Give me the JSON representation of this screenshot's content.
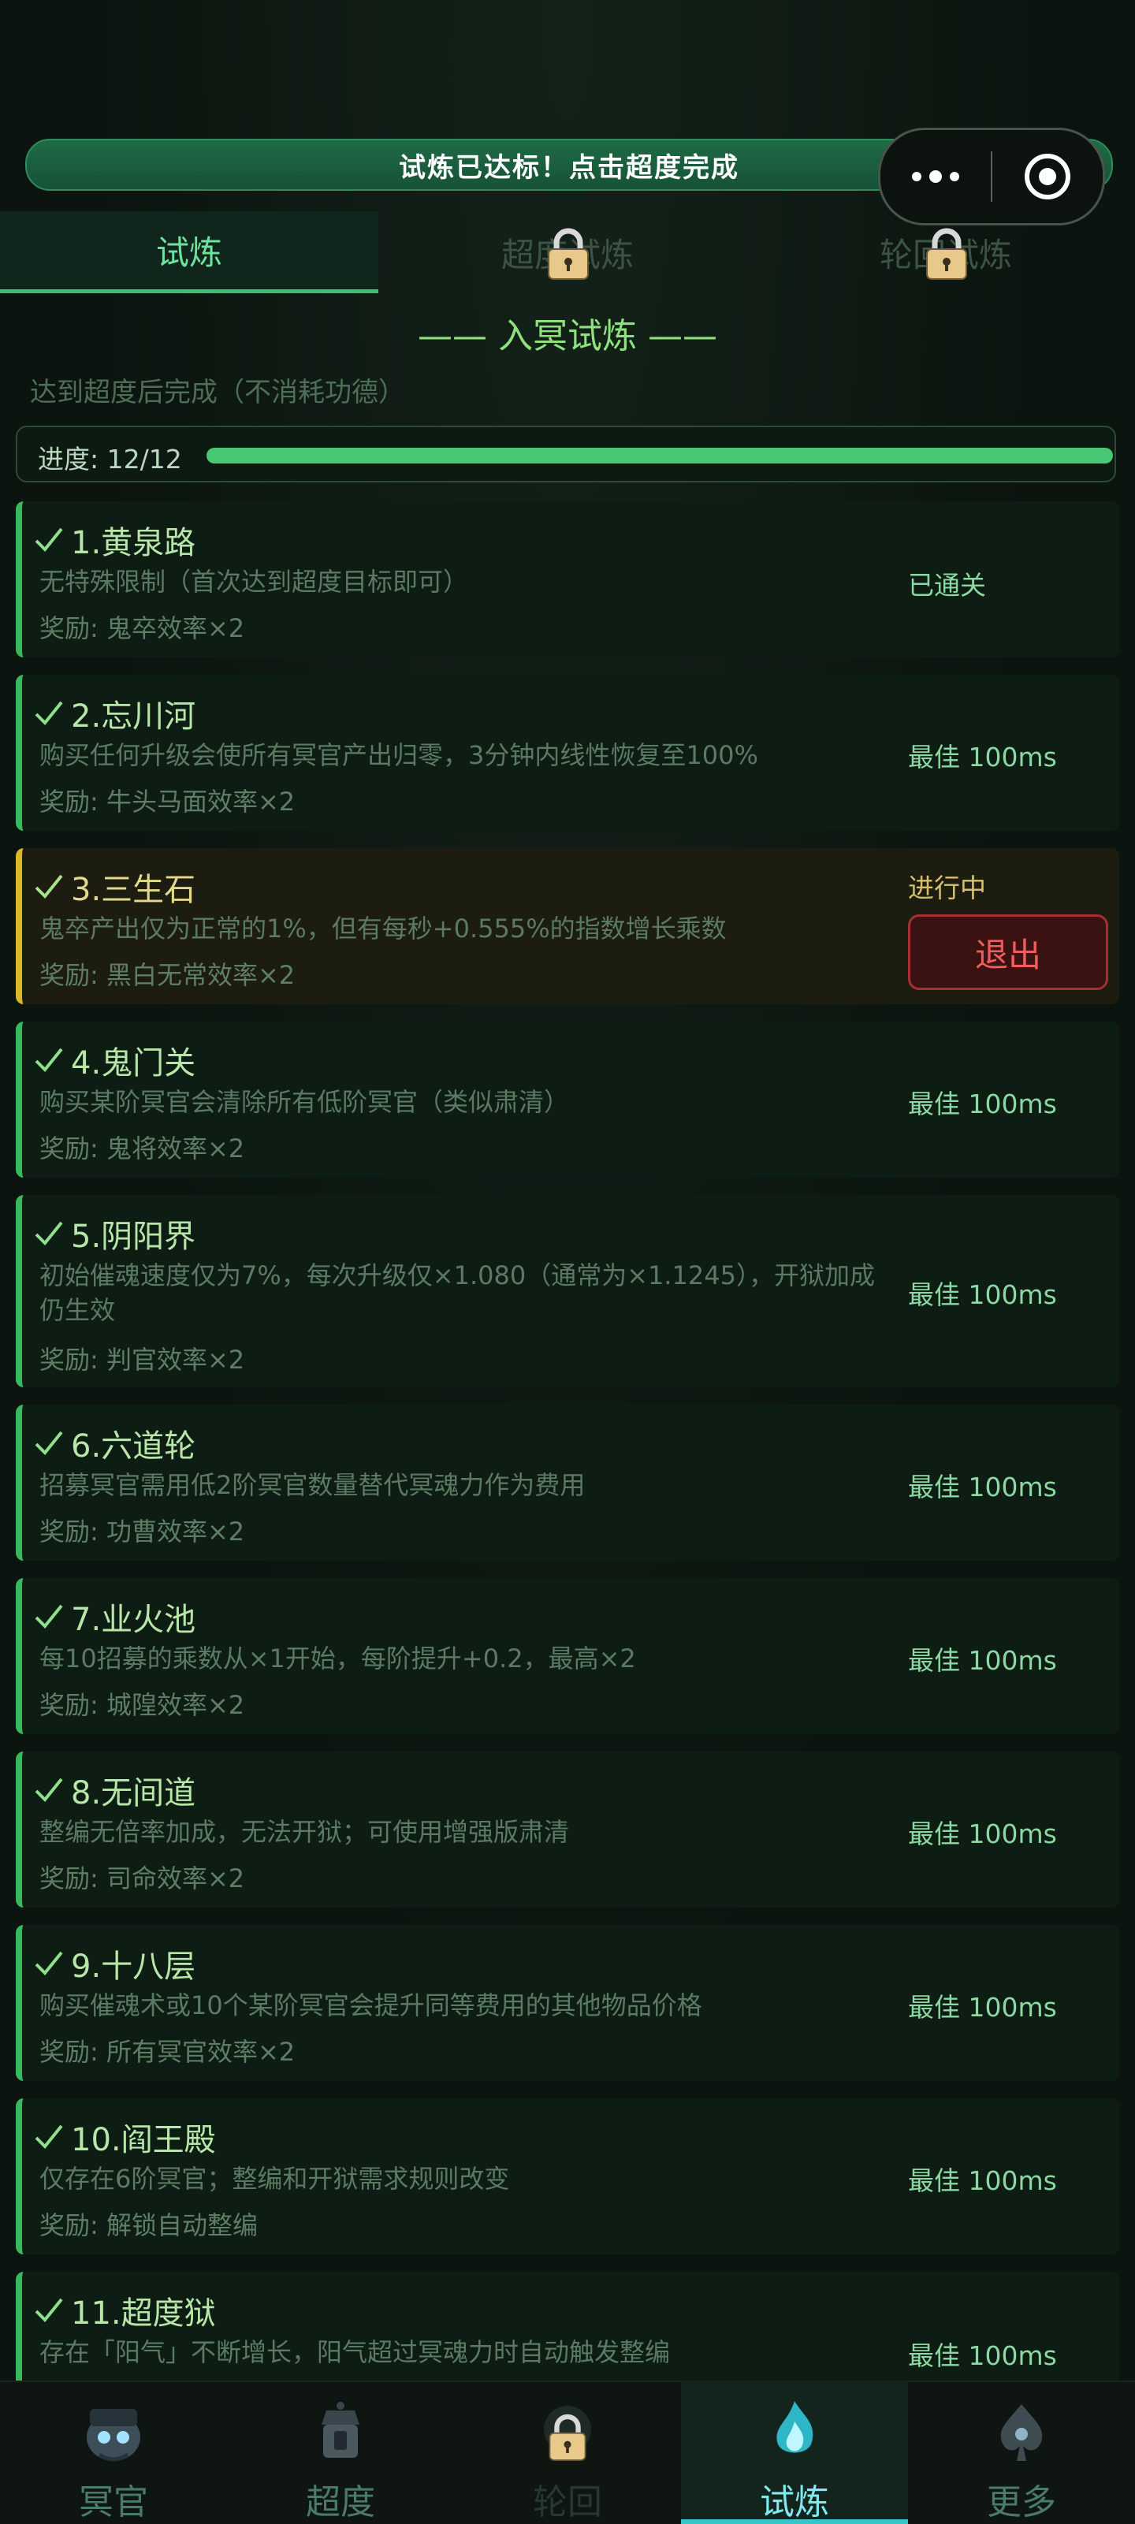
{
  "banner": {
    "text": "试炼已达标！点击超度完成"
  },
  "tabs": [
    {
      "label": "试炼",
      "active": true,
      "locked": false
    },
    {
      "label": "超度试炼",
      "active": false,
      "locked": true
    },
    {
      "label": "轮回试炼",
      "active": false,
      "locked": true
    }
  ],
  "section": {
    "title": "—— 入冥试炼 ——",
    "hint": "达到超度后完成（不消耗功德）"
  },
  "progress": {
    "label": "进度: 12/12",
    "value": 12,
    "max": 12
  },
  "trials": [
    {
      "title": "1.黄泉路",
      "desc": "无特殊限制（首次达到超度目标即可）",
      "reward": "奖励: 鬼卒效率×2",
      "status": "已通关"
    },
    {
      "title": "2.忘川河",
      "desc": "购买任何升级会使所有冥官产出归零，3分钟内线性恢复至100%",
      "reward": "奖励: 牛头马面效率×2",
      "status": "最佳 100ms"
    },
    {
      "title": "3.三生石",
      "desc": "鬼卒产出仅为正常的1%，但有每秒+0.555%的指数增长乘数",
      "reward": "奖励: 黑白无常效率×2",
      "status": "进行中",
      "action": "退出"
    },
    {
      "title": "4.鬼门关",
      "desc": "购买某阶冥官会清除所有低阶冥官（类似肃清）",
      "reward": "奖励: 鬼将效率×2",
      "status": "最佳 100ms"
    },
    {
      "title": "5.阴阳界",
      "desc": "初始催魂速度仅为7%，每次升级仅×1.080（通常为×1.1245），开狱加成仍生效",
      "reward": "奖励: 判官效率×2",
      "status": "最佳 100ms"
    },
    {
      "title": "6.六道轮",
      "desc": "招募冥官需用低2阶冥官数量替代冥魂力作为费用",
      "reward": "奖励: 功曹效率×2",
      "status": "最佳 100ms"
    },
    {
      "title": "7.业火池",
      "desc": "每10招募的乘数从×1开始，每阶提升+0.2，最高×2",
      "reward": "奖励: 城隍效率×2",
      "status": "最佳 100ms"
    },
    {
      "title": "8.无间道",
      "desc": "整编无倍率加成，无法开狱；可使用增强版肃清",
      "reward": "奖励: 司命效率×2",
      "status": "最佳 100ms"
    },
    {
      "title": "9.十八层",
      "desc": "购买催魂术或10个某阶冥官会提升同等费用的其他物品价格",
      "reward": "奖励: 所有冥官效率×2",
      "status": "最佳 100ms"
    },
    {
      "title": "10.阎王殿",
      "desc": "仅存在6阶冥官；整编和开狱需求规则改变",
      "reward": "奖励: 解锁自动整编",
      "status": "最佳 100ms"
    },
    {
      "title": "11.超度狱",
      "desc": "存在「阳气」不断增长，阳气超过冥魂力时自动触发整编",
      "reward": "",
      "status": "最佳 100ms"
    }
  ],
  "bottom_nav": [
    {
      "label": "冥官",
      "icon": "ghost-official-icon",
      "active": false,
      "locked": false
    },
    {
      "label": "超度",
      "icon": "lantern-icon",
      "active": false,
      "locked": false
    },
    {
      "label": "轮回",
      "icon": "reincarnation-icon",
      "active": false,
      "locked": true
    },
    {
      "label": "试炼",
      "icon": "trial-flame-icon",
      "active": true,
      "locked": false
    },
    {
      "label": "更多",
      "icon": "spade-emblem-icon",
      "active": false,
      "locked": false
    }
  ],
  "colors": {
    "accent": "#3ac176",
    "current": "#d9b92b",
    "exit": "#ef5d5d"
  }
}
